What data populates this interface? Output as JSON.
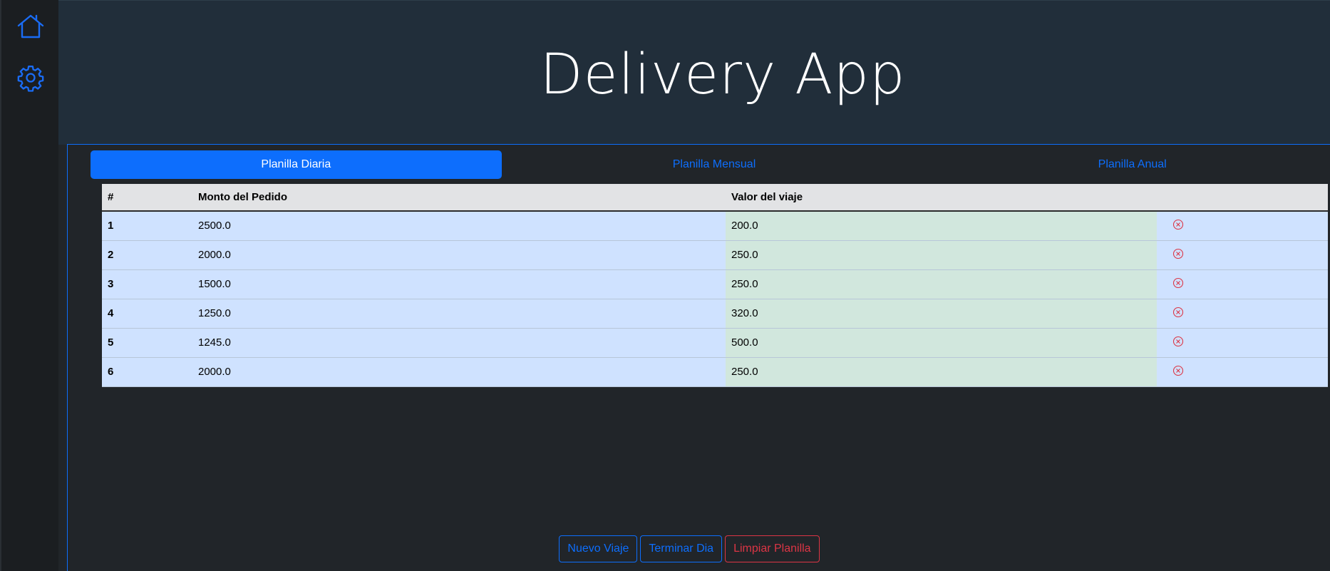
{
  "app": {
    "title": "Delivery App"
  },
  "sidebar": {
    "items": [
      {
        "icon": "home-icon"
      },
      {
        "icon": "gear-icon"
      }
    ]
  },
  "tabs": [
    {
      "label": "Planilla Diaria",
      "active": true
    },
    {
      "label": "Planilla Mensual",
      "active": false
    },
    {
      "label": "Planilla Anual",
      "active": false
    }
  ],
  "table": {
    "headers": [
      "#",
      "Monto del Pedido",
      "Valor del viaje",
      ""
    ],
    "rows": [
      {
        "num": "1",
        "monto": "2500.0",
        "valor": "200.0"
      },
      {
        "num": "2",
        "monto": "2000.0",
        "valor": "250.0"
      },
      {
        "num": "3",
        "monto": "1500.0",
        "valor": "250.0"
      },
      {
        "num": "4",
        "monto": "1250.0",
        "valor": "320.0"
      },
      {
        "num": "5",
        "monto": "1245.0",
        "valor": "500.0"
      },
      {
        "num": "6",
        "monto": "2000.0",
        "valor": "250.0"
      }
    ]
  },
  "actions": {
    "new_trip": "Nuevo Viaje",
    "end_day": "Terminar Dia",
    "clear_sheet": "Limpiar Planilla"
  },
  "colors": {
    "accent": "#0d6efd",
    "danger": "#dc3545",
    "row_primary": "#cfe2ff",
    "row_success": "#d1e7dd"
  }
}
